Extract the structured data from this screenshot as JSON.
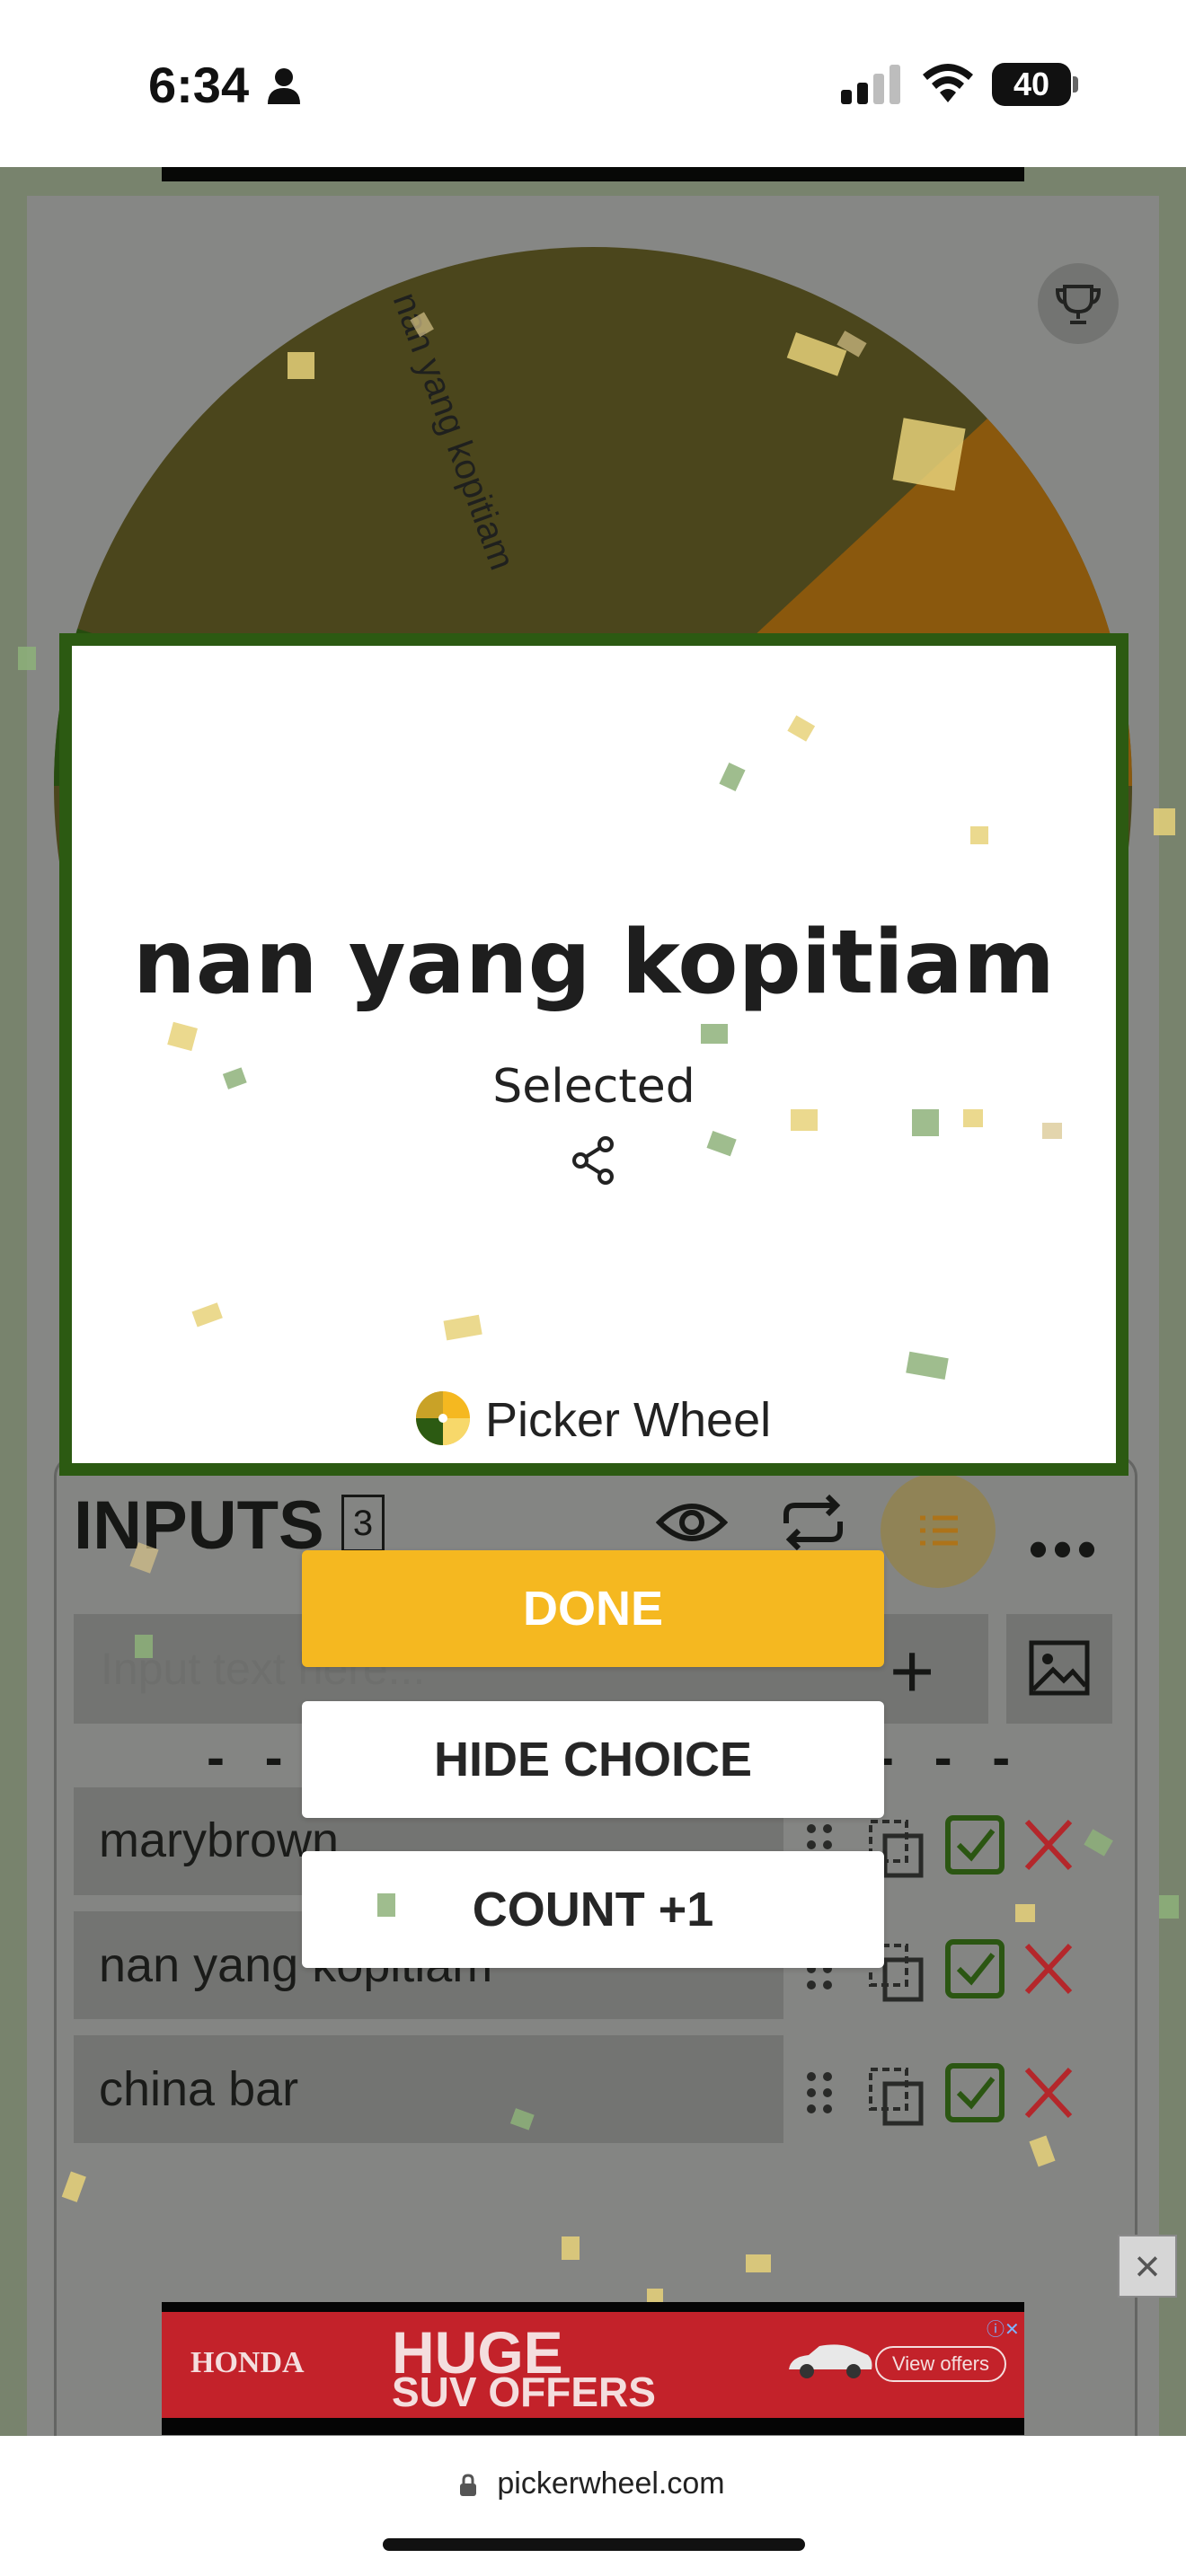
{
  "status_bar": {
    "time": "6:34",
    "battery": "40"
  },
  "wheel": {
    "label": "nan yang kopitiam",
    "colors": {
      "slice_main": "#5b5222",
      "slice_orange": "#a8690f",
      "slice_green": "#2c5a12"
    }
  },
  "modal": {
    "result": "nan yang kopitiam",
    "subtitle": "Selected",
    "brand": "Picker Wheel",
    "border_color": "#2c5a12"
  },
  "buttons": {
    "done": "DONE",
    "hide_choice": "HIDE CHOICE",
    "count": "COUNT +1"
  },
  "inputs_panel": {
    "title": "INPUTS",
    "count": "3",
    "placeholder": "Input text here...",
    "items": [
      {
        "label": "marybrown",
        "checked": true
      },
      {
        "label": "nan yang kopitiam",
        "checked": true
      },
      {
        "label": "china bar",
        "checked": true
      }
    ]
  },
  "ad": {
    "brand": "HONDA",
    "headline": "HUGE",
    "subline": "SUV OFFERS",
    "cta": "View offers"
  },
  "browser": {
    "url": "pickerwheel.com"
  },
  "colors": {
    "accent": "#f5b820",
    "check_green": "#2c5a12",
    "delete_red": "#c0272d"
  }
}
